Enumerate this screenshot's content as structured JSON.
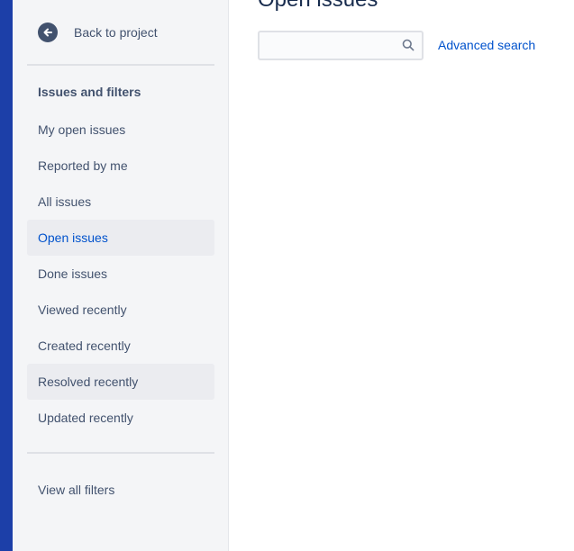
{
  "sidebar": {
    "back_label": "Back to project",
    "section_title": "Issues and filters",
    "items": [
      {
        "label": "My open issues"
      },
      {
        "label": "Reported by me"
      },
      {
        "label": "All issues"
      },
      {
        "label": "Open issues",
        "active": true
      },
      {
        "label": "Done issues"
      },
      {
        "label": "Viewed recently"
      },
      {
        "label": "Created recently"
      },
      {
        "label": "Resolved recently"
      },
      {
        "label": "Updated recently"
      }
    ],
    "view_all_label": "View all filters"
  },
  "main": {
    "title": "Open issues",
    "search": {
      "value": "",
      "placeholder": ""
    },
    "advanced_search_label": "Advanced search"
  },
  "colors": {
    "nav_strip": "#1c3fa8",
    "sidebar_bg": "#f4f5f7",
    "text": "#42526e",
    "link": "#0052cc",
    "selected_bg": "#ebecf0"
  },
  "icons": {
    "back": "arrow-left-circle-icon",
    "search": "magnifier-icon"
  }
}
